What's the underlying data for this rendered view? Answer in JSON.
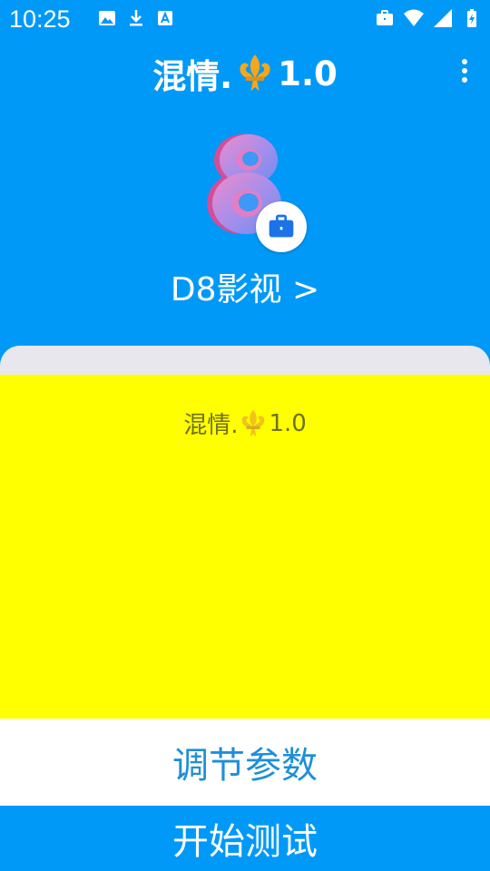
{
  "status_bar": {
    "time": "10:25",
    "left_icons": [
      "image-icon",
      "download-icon",
      "app-store-icon"
    ],
    "right_icons": [
      "work-briefcase-icon",
      "wifi-icon",
      "cell-signal-icon",
      "battery-charging-icon"
    ]
  },
  "app_bar": {
    "title_prefix": "混情.",
    "title_suffix": "1.0",
    "menu_icon": "more-vertical-icon"
  },
  "app": {
    "logo_icon": "d8-logo-icon",
    "badge_icon": "work-briefcase-icon",
    "name": "D8影视 >"
  },
  "panel": {
    "text_prefix": "混情.",
    "text_suffix": "1.0"
  },
  "buttons": {
    "adjust_label": "调节参数",
    "start_label": "开始测试"
  },
  "colors": {
    "primary": "#0099F8",
    "panel": "#FFFF00",
    "sheet": "#E8E7EE",
    "accent_text": "#1E8FD8"
  }
}
